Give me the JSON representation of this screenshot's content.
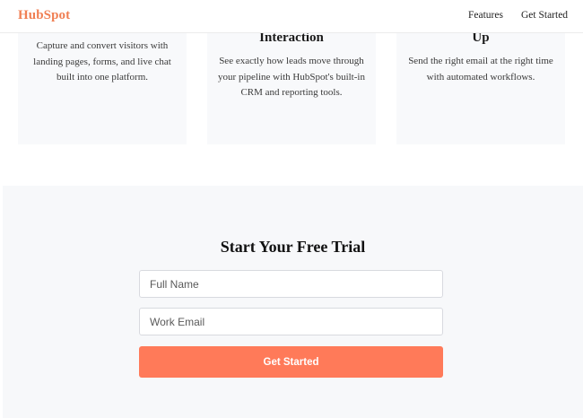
{
  "header": {
    "logo": "HubSpot",
    "nav": {
      "features": "Features",
      "get_started": "Get Started"
    }
  },
  "features": [
    {
      "title": "",
      "text": "Capture and convert visitors with landing pages, forms, and live chat built into one platform."
    },
    {
      "title": "Interaction",
      "text": "See exactly how leads move through your pipeline with HubSpot's built-in CRM and reporting tools."
    },
    {
      "title": "Up",
      "text": "Send the right email at the right time with automated workflows."
    }
  ],
  "trial": {
    "title": "Start Your Free Trial",
    "name_placeholder": "Full Name",
    "email_placeholder": "Work Email",
    "submit_label": "Get Started"
  },
  "colors": {
    "brand": "#f07f53",
    "button": "#ff7a59",
    "section_bg": "#f7f8fa",
    "card_bg": "#f8f9fb"
  }
}
